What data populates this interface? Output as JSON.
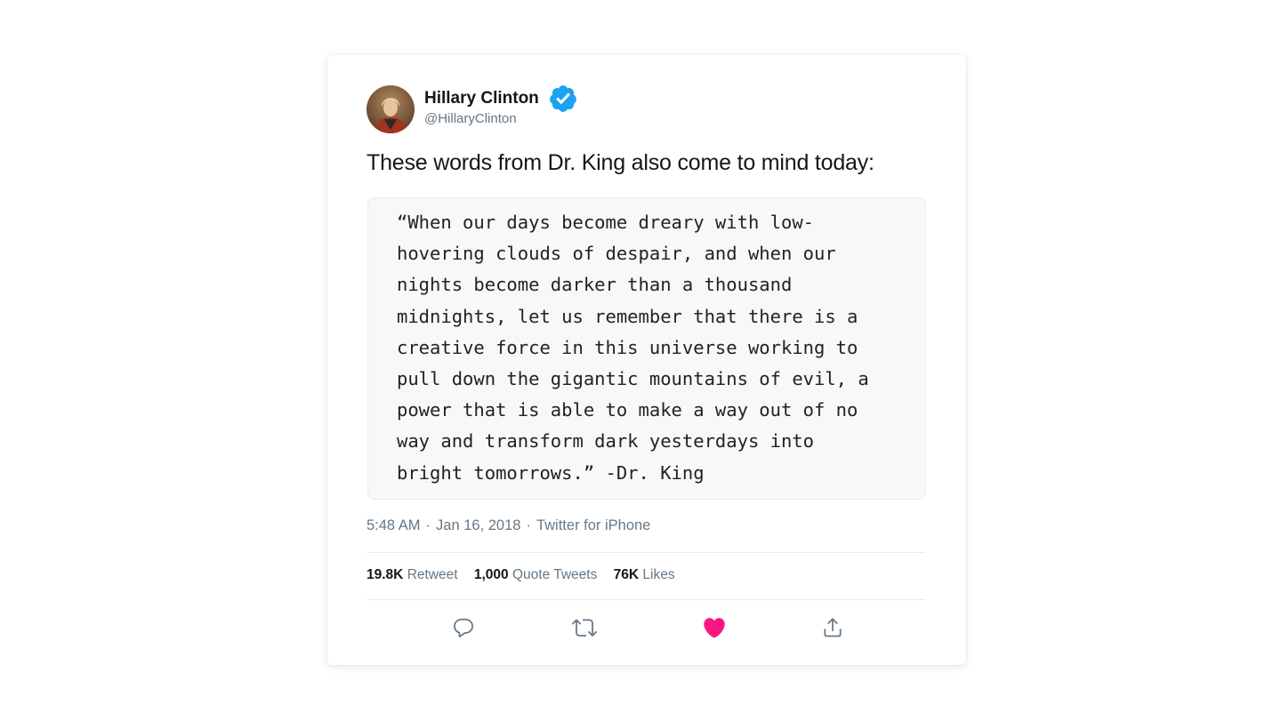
{
  "tweet": {
    "author": {
      "display_name": "Hillary Clinton",
      "handle": "@HillaryClinton",
      "verified": true,
      "verified_badge_icon": "verified-badge-icon",
      "avatar_icon": "profile-photo"
    },
    "text": "These words from Dr. King also come to mind today:",
    "quote_lines": [
      "“When our days become dreary with low-",
      "hovering clouds of despair, and when our",
      "nights become darker than a thousand",
      "midnights, let us remember that there is a",
      "creative force in this universe working to",
      "pull down the gigantic mountains of evil, a",
      "power that is able to make a way out of no",
      "way and transform dark yesterdays into",
      "bright tomorrows.” -Dr. King"
    ],
    "meta": {
      "time": "5:48 AM",
      "date": "Jan 16, 2018",
      "source": "Twitter for iPhone",
      "separator": "·"
    },
    "stats": {
      "retweets_count": "19.8K",
      "retweets_label": "Retweet",
      "quotes_count": "1,000",
      "quotes_label": "Quote Tweets",
      "likes_count": "76K",
      "likes_label": "Likes"
    },
    "actions": [
      {
        "name": "reply",
        "icon": "reply-icon"
      },
      {
        "name": "retweet",
        "icon": "retweet-icon"
      },
      {
        "name": "like",
        "icon": "heart-icon",
        "active": true
      },
      {
        "name": "share",
        "icon": "share-icon"
      }
    ]
  },
  "colors": {
    "verified_blue": "#1da1f2",
    "like_pink": "#e0245e",
    "secondary_text": "#657786",
    "primary_text": "#14171a"
  }
}
